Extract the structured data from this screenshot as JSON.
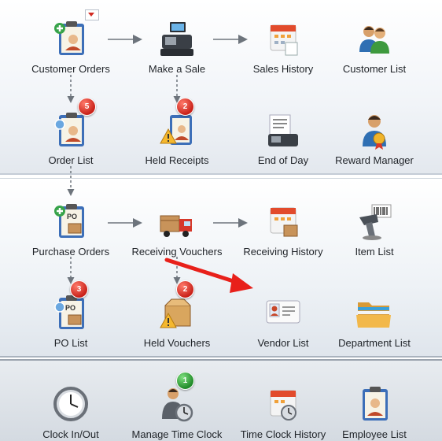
{
  "tiles": {
    "customer_orders": "Customer Orders",
    "make_a_sale": "Make a Sale",
    "sales_history": "Sales History",
    "customer_list": "Customer List",
    "order_list": "Order List",
    "held_receipts": "Held Receipts",
    "end_of_day": "End of Day",
    "reward_manager": "Reward Manager",
    "purchase_orders": "Purchase Orders",
    "receiving_vouchers": "Receiving Vouchers",
    "receiving_history": "Receiving History",
    "item_list": "Item List",
    "po_list": "PO List",
    "held_vouchers": "Held Vouchers",
    "vendor_list": "Vendor List",
    "department_list": "Department List",
    "clock_in_out": "Clock In/Out",
    "manage_time_clock": "Manage Time Clock",
    "time_clock_history": "Time Clock History",
    "employee_list": "Employee List"
  },
  "badges": {
    "order_list": "5",
    "held_receipts": "2",
    "po_list": "3",
    "held_vouchers": "2",
    "manage_time_clock": "1"
  },
  "icon_labels": {
    "po": "PO"
  },
  "colors": {
    "badge_red": "#c9221a",
    "badge_green": "#218a2a",
    "annotation_arrow": "#e8201a"
  }
}
